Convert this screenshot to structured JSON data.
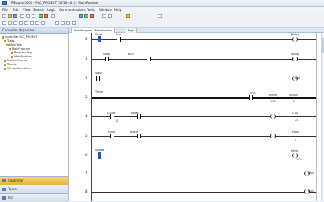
{
  "window": {
    "title": "RSLogix 5000 - PLC_PROJECT [1756-L61] - MainRoutine"
  },
  "menu": [
    "File",
    "Edit",
    "View",
    "Search",
    "Logic",
    "Communications",
    "Tools",
    "Window",
    "Help"
  ],
  "sidebar": {
    "header": "Controller Organizer",
    "tree": [
      "Controller PLC_PROJECT",
      "Tasks",
      "MainTask",
      "MainProgram",
      "Program Tags",
      "MainRoutine",
      "Motion Groups",
      "Trends",
      "I/O Configuration"
    ],
    "nav": [
      "Controller",
      "Tasks",
      "I/O"
    ]
  },
  "tabs": [
    "MainProgram - MainRoutine",
    "Tags"
  ],
  "rungs": [
    {
      "num": "0",
      "label_a": "Start",
      "label_b": "Run",
      "coil_label": "Motor",
      "coil_val": "1"
    },
    {
      "num": "1",
      "label_a": "Stop",
      "label_b": "Run",
      "coil_label": "Pump",
      "coil_val": ""
    },
    {
      "num": "2",
      "label_a": "Valve",
      "coil_label": "Fan"
    },
    {
      "num": "3",
      "label_a": "Timer",
      "box_label": "TON",
      "box_a": "Preset",
      "box_a_val": "100",
      "box_b": "Accum",
      "box_b_val": "0"
    },
    {
      "num": "4",
      "label_a": "Count",
      "label_b": "Reset",
      "val_a": "12",
      "box_label": "CTU",
      "box_val": "24"
    },
    {
      "num": "5",
      "label_a": "Level",
      "label_b": "Alarm",
      "val_a": "3",
      "coil_label": "Horn",
      "coil_val": "0"
    },
    {
      "num": "6",
      "label_a": "Speed",
      "coil_label": "Drive",
      "coil_val": "1500"
    },
    {
      "num": "7",
      "coil_label": "End"
    },
    {
      "num": "8",
      "coil_label": "End"
    }
  ]
}
